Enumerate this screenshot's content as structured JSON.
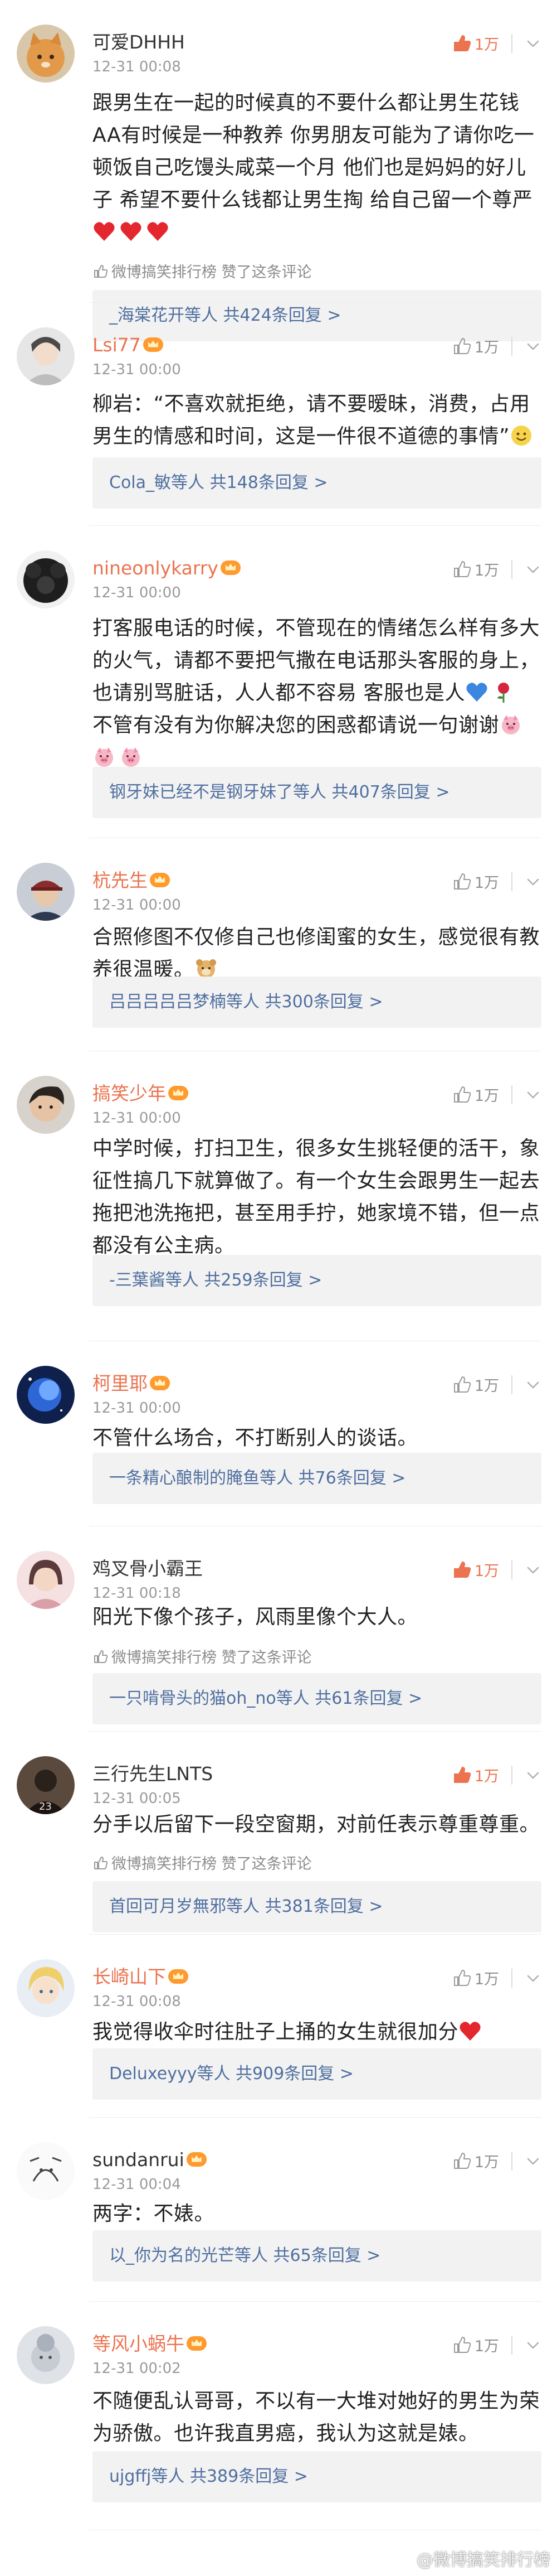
{
  "comments": [
    {
      "user": "可爱DHHH",
      "vip": false,
      "name_color": "normal",
      "time": "12-31 00:08",
      "likes": "1万",
      "liked": true,
      "lines": [
        "跟男生在一起的时候真的不要什么都让男生花钱",
        "AA有时候是一种教养 你男朋友可能为了请你吃一",
        "顿饭自己吃馒头咸菜一个月 他们也是妈妈的好儿",
        "子 希望不要什么钱都让男生掏 给自己留一个尊严"
      ],
      "emoji_line": [
        "red-heart",
        "red-heart",
        "red-heart"
      ],
      "note": "微博搞笑排行榜 赞了这条评论",
      "reply_user": "_海棠花开等人",
      "reply_count": "共424条回复 >",
      "avatar": "orange-cat"
    },
    {
      "user": "Lsi77",
      "vip": true,
      "name_color": "orange",
      "time": "12-31 00:00",
      "likes": "1万",
      "liked": false,
      "lines": [
        "柳岩：“不喜欢就拒绝，请不要暧昧，消费，占用",
        "男生的情感和时间，这是一件很不道德的事情”"
      ],
      "trailing_emoji": "smile",
      "note": "",
      "reply_user": "Cola_敏等人",
      "reply_count": "共148条回复 >",
      "avatar": "grey-portrait"
    },
    {
      "user": "nineonlykarry",
      "vip": true,
      "name_color": "orange",
      "time": "12-31 00:00",
      "likes": "1万",
      "liked": false,
      "lines": [
        "打客服电话的时候，不管现在的情绪怎么样有多大",
        "的火气，请都不要把气撒在电话那头客服的身上，",
        "也请别骂脏话，人人都不容易 客服也是人",
        "不管有没有为你解决您的困惑都请说一句谢谢"
      ],
      "emoji_line": [
        "pig",
        "pig"
      ],
      "note": "",
      "reply_user": "钢牙妹已经不是钢牙妹了等人",
      "reply_count": "共407条回复 >",
      "avatar": "dark-hair"
    },
    {
      "user": "杭先生",
      "vip": true,
      "name_color": "orange",
      "time": "12-31 00:00",
      "likes": "1万",
      "liked": false,
      "lines": [
        "合照修图不仅修自己也修闺蜜的女生，感觉很有教",
        "养很温暖。"
      ],
      "note": "",
      "reply_user": "吕吕吕吕吕梦楠等人",
      "reply_count": "共300条回复 >",
      "avatar": "man-cap"
    },
    {
      "user": "搞笑少年",
      "vip": true,
      "name_color": "orange",
      "time": "12-31 00:00",
      "likes": "1万",
      "liked": false,
      "lines": [
        "中学时候，打扫卫生，很多女生挑轻便的活干，象",
        "征性搞几下就算做了。有一个女生会跟男生一起去",
        "拖把池洗拖把，甚至用手拧，她家境不错，但一点",
        "都没有公主病。"
      ],
      "note": "",
      "reply_user": "-三葉酱等人",
      "reply_count": "共259条回复 >",
      "avatar": "man-face"
    },
    {
      "user": "柯里耶",
      "vip": true,
      "name_color": "orange",
      "time": "12-31 00:00",
      "likes": "1万",
      "liked": false,
      "lines": [
        "不管什么场合，不打断别人的谈话。"
      ],
      "note": "",
      "reply_user": "一条精心酿制的腌鱼等人",
      "reply_count": "共76条回复 >",
      "avatar": "blue-night"
    },
    {
      "user": "鸡叉骨小霸王",
      "vip": false,
      "name_color": "normal",
      "time": "12-31 00:18",
      "likes": "1万",
      "liked": true,
      "lines": [
        "阳光下像个孩子，风雨里像个大人。"
      ],
      "note": "微博搞笑排行榜 赞了这条评论",
      "reply_user": "一只啃骨头的猫oh_no等人",
      "reply_count": "共61条回复 >",
      "avatar": "girl-pink"
    },
    {
      "user": "三行先生LNTS",
      "vip": false,
      "name_color": "normal",
      "time": "12-31 00:05",
      "likes": "1万",
      "liked": true,
      "lines": [
        "分手以后留下一段空窗期，对前任表示尊重尊重。"
      ],
      "note": "微博搞笑排行榜 赞了这条评论",
      "reply_user": "首回可月岁無邪等人",
      "reply_count": "共381条回复 >",
      "avatar": "dark-figure"
    },
    {
      "user": "长崎山下",
      "vip": true,
      "name_color": "orange",
      "time": "12-31 00:08",
      "likes": "1万",
      "liked": false,
      "lines": [
        "我觉得收伞时往肚子上捅的女生就很加分"
      ],
      "trailing_emoji": "red-heart",
      "note": "",
      "reply_user": "Deluxeyyy等人",
      "reply_count": "共909条回复 >",
      "avatar": "anime-blonde"
    },
    {
      "user": "sundanrui",
      "vip": true,
      "name_color": "normal",
      "time": "12-31 00:04",
      "likes": "1万",
      "liked": false,
      "lines": [
        "两字：不婊。"
      ],
      "note": "",
      "reply_user": "以_你为名的光芒等人",
      "reply_count": "共65条回复 >",
      "avatar": "sketch"
    },
    {
      "user": "等风小蜗牛",
      "vip": true,
      "name_color": "orange",
      "time": "12-31 00:02",
      "likes": "1万",
      "liked": false,
      "lines": [
        "不随便乱认哥哥，不以有一大堆对她好的男生为荣",
        "为骄傲。也许我直男癌，我认为这就是婊。"
      ],
      "note": "",
      "reply_user": "ujgffj等人",
      "reply_count": "共389条回复 >",
      "avatar": "grey-doll"
    }
  ],
  "watermark": "@微博搞笑排行榜",
  "colors": {
    "accent": "#eb7350",
    "link": "#4f6fa0",
    "reply_bg": "#f2f2f2",
    "meta": "#9a9a9a"
  }
}
